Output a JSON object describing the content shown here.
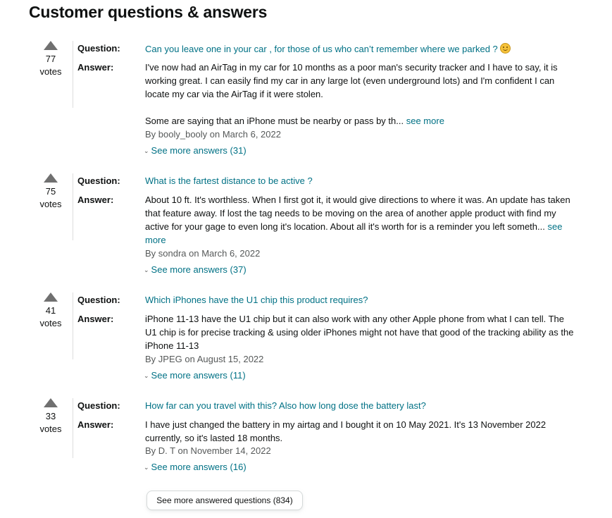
{
  "header": {
    "title": "Customer questions & answers"
  },
  "labels": {
    "question": "Question:",
    "answer": "Answer:",
    "votes": "votes"
  },
  "qa": [
    {
      "votes": "77",
      "question": "Can you leave one in your car , for those of us who can’t remember where we parked ?",
      "question_emoji": "smiley-emoji",
      "answer_paragraphs": [
        "I've now had an AirTag in my car for 10 months as a poor man's security tracker and I have to say, it is working great. I can easily find my car in any large lot (even underground lots) and I'm confident I can locate my car via the AirTag if it were stolen.",
        "Some are saying that an iPhone must be nearby or pass by th..."
      ],
      "see_more": "see more",
      "byline": "By booly_booly on March 6, 2022",
      "more_answers": "See more answers (31)"
    },
    {
      "votes": "75",
      "question": "What is the fartest distance to be active ?",
      "answer_paragraphs": [
        "About 10 ft. It's worthless. When I first got it, it would give directions to where it was. An update has taken that feature away. If lost the tag needs to be moving on the area of another apple product with find my active for your gage to even long it's location. About all it's worth for is a reminder you left someth..."
      ],
      "see_more": "see more",
      "byline": "By sondra on March 6, 2022",
      "more_answers": "See more answers (37)"
    },
    {
      "votes": "41",
      "question": "Which iPhones have the U1 chip this product requires?",
      "answer_paragraphs": [
        "iPhone 11-13 have the U1 chip but it can also work with any other Apple phone from what I can tell. The U1 chip is for precise tracking & using older iPhones might not have that good of the tracking ability as the iPhone 11-13"
      ],
      "byline": "By JPEG on August 15, 2022",
      "more_answers": "See more answers (11)"
    },
    {
      "votes": "33",
      "question": "How far can you travel with this? Also how long dose the battery last?",
      "answer_paragraphs": [
        "I have just changed the battery in my airtag and I bought it on 10 May 2021. It's 13 November 2022 currently, so it's lasted 18 months."
      ],
      "byline": "By D. T on November 14, 2022",
      "more_answers": "See more answers (16)"
    }
  ],
  "footer": {
    "button_label": "See more answered questions (834)"
  },
  "colors": {
    "link": "#007185",
    "text": "#0f1111",
    "muted": "#565959",
    "vote_arrow": "#707070"
  }
}
